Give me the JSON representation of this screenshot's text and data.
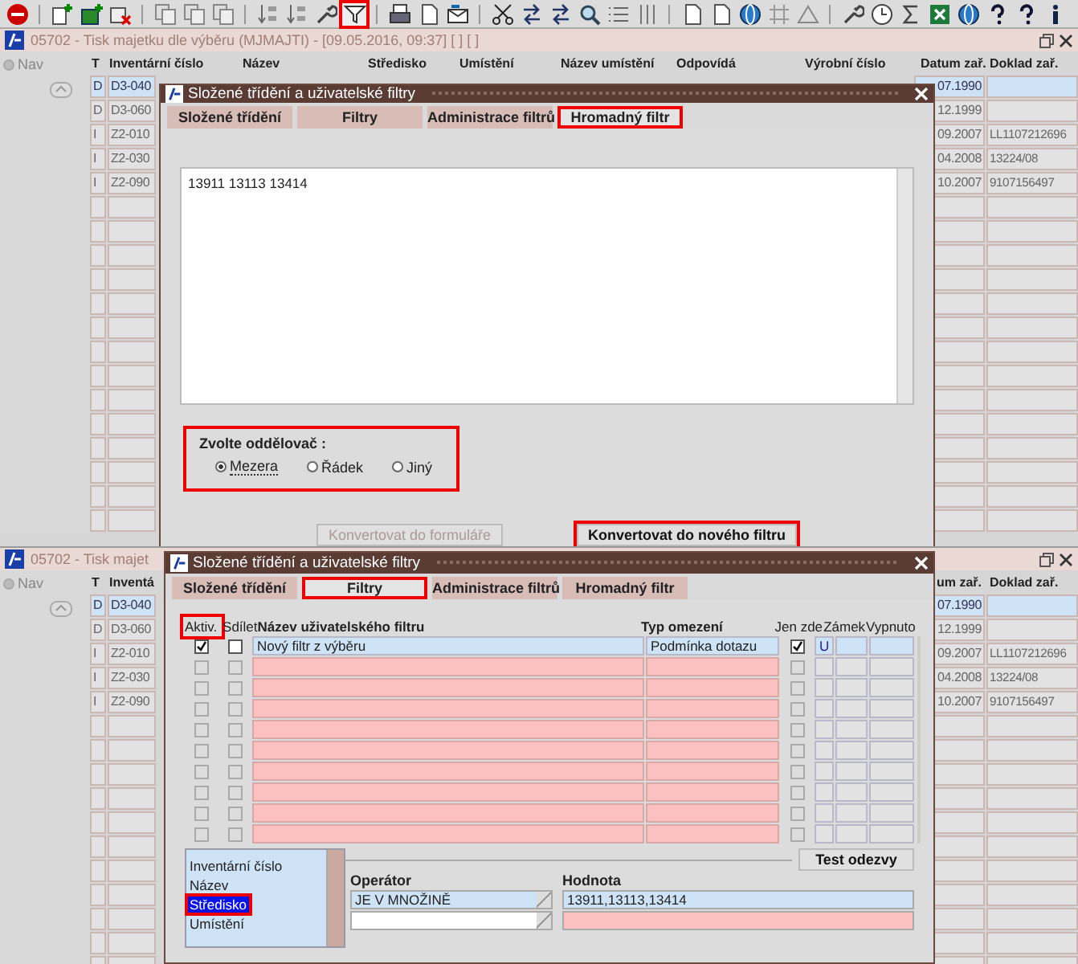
{
  "toolbar": {
    "groups": [
      [
        {
          "highlighted": false
        }
      ],
      [
        {
          "highlighted": false
        },
        {
          "highlighted": false
        },
        {
          "highlighted": false
        }
      ],
      [
        {
          "highlighted": false
        },
        {
          "highlighted": false
        },
        {
          "highlighted": false
        }
      ],
      [
        {
          "highlighted": false
        },
        {
          "highlighted": false
        },
        {
          "highlighted": false
        },
        {
          "highlighted": true
        }
      ],
      [
        {
          "highlighted": false
        },
        {
          "highlighted": false
        },
        {
          "highlighted": false
        }
      ],
      [
        {
          "highlighted": false
        },
        {
          "highlighted": false
        },
        {
          "highlighted": false
        },
        {
          "highlighted": false
        },
        {
          "highlighted": false
        },
        {
          "highlighted": false
        }
      ],
      [
        {
          "highlighted": false
        },
        {
          "highlighted": false
        },
        {
          "highlighted": false
        },
        {
          "highlighted": false
        },
        {
          "highlighted": false
        }
      ],
      [
        {
          "highlighted": false
        },
        {
          "highlighted": false
        },
        {
          "highlighted": false
        },
        {
          "highlighted": false
        },
        {
          "highlighted": false
        },
        {
          "highlighted": false
        },
        {
          "highlighted": false
        },
        {
          "highlighted": false
        }
      ]
    ]
  },
  "panels": [
    {
      "app_title": "05702 - Tisk majetku dle výběru (MJMAJTI) - [09.05.2016, 09:37]  [ ]  [ ]",
      "nav": "Nav",
      "nav_selected": false,
      "header": [
        "T",
        "Inventární číslo",
        "Název",
        "Středisko",
        "Umístění",
        "Název umístění",
        "Odpovídá",
        "Výrobní číslo",
        "Datum zař.",
        "Doklad zař."
      ],
      "rows": [
        {
          "type": "D",
          "code": "D3-040",
          "date": "07.1990",
          "selected": true
        },
        {
          "type": "D",
          "code": "D3-060",
          "date": "12.1999",
          "selected": false
        },
        {
          "type": "I",
          "code": "Z2-010",
          "date": "09.2007",
          "doc": "LL1107212696",
          "selected": false
        },
        {
          "type": "I",
          "code": "Z2-030",
          "date": "04.2008",
          "doc": "13224/08",
          "selected": false
        },
        {
          "type": "I",
          "code": "Z2-090",
          "date": "10.2007",
          "doc": "9107156497",
          "selected": false
        }
      ],
      "dialog": {
        "kind": "bulk",
        "title": "Složené třídění a uživatelské filtry",
        "tabs": [
          {
            "label": "Složené třídění",
            "selected": false,
            "highlighted": false
          },
          {
            "label": "Filtry",
            "selected": false,
            "highlighted": false
          },
          {
            "label": "Administrace filtrů",
            "selected": false,
            "highlighted": false
          },
          {
            "label": "Hromadný filtr",
            "selected": true,
            "highlighted": true
          }
        ],
        "text": "13911 13113  13414",
        "separator": {
          "label": "Zvolte oddělovač :",
          "highlighted": true,
          "options": [
            {
              "label": "Mezera",
              "selected": true
            },
            {
              "label": "Řádek",
              "selected": false
            },
            {
              "label": "Jiný",
              "selected": false
            }
          ]
        },
        "buttons": [
          {
            "label": "Konvertovat do formuláře",
            "disabled": true,
            "highlighted": false
          },
          {
            "label": "Konvertovat do nového filtru",
            "disabled": false,
            "highlighted": true
          }
        ]
      }
    },
    {
      "app_title": "05702 - Tisk majet",
      "nav": "Nav",
      "nav_selected": false,
      "header": [
        "T",
        "Inventá",
        "um zař.",
        "Doklad zař."
      ],
      "rows": [
        {
          "type": "D",
          "code": "D3-040",
          "date": "07.1990",
          "selected": true
        },
        {
          "type": "D",
          "code": "D3-060",
          "date": "12.1999",
          "selected": false
        },
        {
          "type": "I",
          "code": "Z2-010",
          "date": "09.2007",
          "doc": "LL1107212696",
          "selected": false
        },
        {
          "type": "I",
          "code": "Z2-030",
          "date": "04.2008",
          "doc": "13224/08",
          "selected": false
        },
        {
          "type": "I",
          "code": "Z2-090",
          "date": "10.2007",
          "doc": "9107156497",
          "selected": false
        }
      ],
      "dialog": {
        "kind": "filters",
        "title": "Složené třídění a uživatelské filtry",
        "tabs": [
          {
            "label": "Složené třídění",
            "selected": false,
            "highlighted": false
          },
          {
            "label": "Filtry",
            "selected": true,
            "highlighted": true
          },
          {
            "label": "Administrace filtrů",
            "selected": false,
            "highlighted": false
          },
          {
            "label": "Hromadný filtr",
            "selected": false,
            "highlighted": false
          }
        ],
        "columns": [
          {
            "label": "Aktiv.",
            "highlighted": true
          },
          {
            "label": "Sdílet",
            "highlighted": false
          },
          {
            "label": "Název uživatelského filtru",
            "highlighted": false
          },
          {
            "label": "Typ omezení",
            "highlighted": false
          },
          {
            "label": "Jen zde",
            "highlighted": false
          },
          {
            "label": "Zámek",
            "highlighted": false
          },
          {
            "label": "Vypnuto",
            "highlighted": false
          }
        ],
        "filters": [
          {
            "active": true,
            "shared": false,
            "name": "Nový filtr z výběru",
            "type": "Podmínka dotazu",
            "local": true,
            "lock": "U",
            "empty": false
          },
          {
            "active": false,
            "shared": false,
            "local": false,
            "empty": true
          },
          {
            "active": false,
            "shared": false,
            "local": false,
            "empty": true
          },
          {
            "active": false,
            "shared": false,
            "local": false,
            "empty": true
          },
          {
            "active": false,
            "shared": false,
            "local": false,
            "empty": true
          },
          {
            "active": false,
            "shared": false,
            "local": false,
            "empty": true
          },
          {
            "active": false,
            "shared": false,
            "local": false,
            "empty": true
          },
          {
            "active": false,
            "shared": false,
            "local": false,
            "empty": true
          },
          {
            "active": false,
            "shared": false,
            "local": false,
            "empty": true
          },
          {
            "active": false,
            "shared": false,
            "local": false,
            "empty": true
          }
        ],
        "test_button": "Test odezvy",
        "column_list": [
          {
            "label": "Inventární číslo",
            "selected": false,
            "highlighted": false
          },
          {
            "label": "Název",
            "selected": false,
            "highlighted": false
          },
          {
            "label": "Středisko",
            "selected": true,
            "highlighted": true
          },
          {
            "label": "Umístění",
            "selected": false,
            "highlighted": false
          }
        ],
        "operator_label": "Operátor",
        "value_label": "Hodnota",
        "conditions": [
          {
            "operator": "JE V MNOŽINĚ",
            "value": "13911,13113,13414",
            "filled": true
          },
          {
            "filled": false
          }
        ]
      }
    }
  ]
}
